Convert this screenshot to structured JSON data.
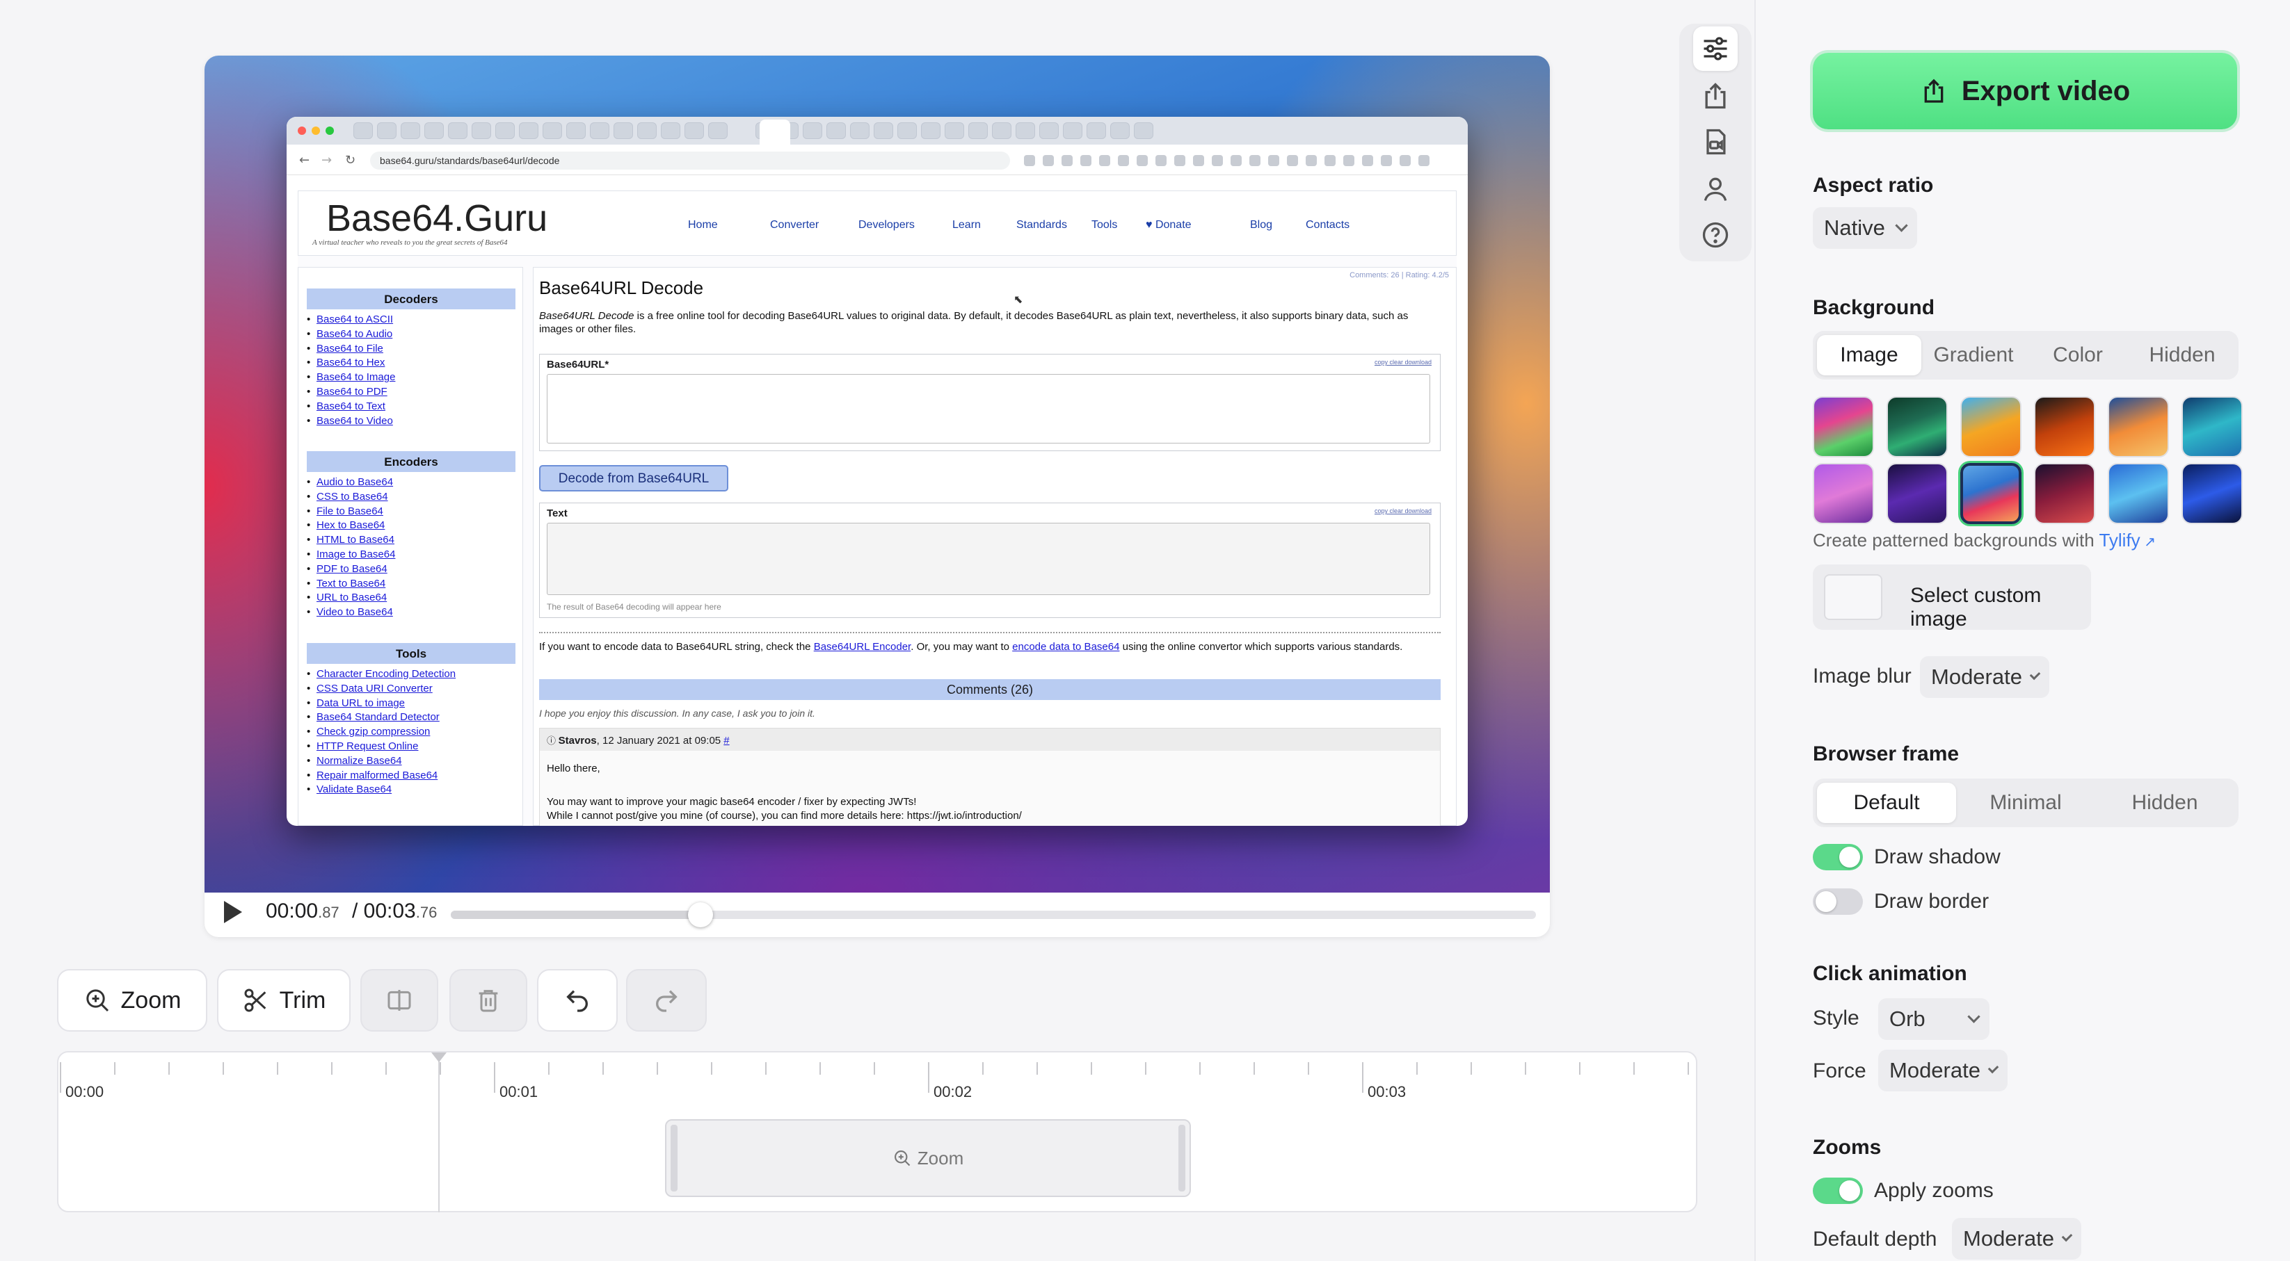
{
  "colors": {
    "accent": "#5bd98a",
    "export_bg": "#5fe88e",
    "link": "#3d7bf0"
  },
  "browser": {
    "url": "base64.guru/standards/base64url/decode",
    "site": {
      "logo": "Base64.Guru",
      "tagline": "A virtual teacher who reveals to you the great secrets of Base64",
      "nav": [
        "Home",
        "Converter",
        "Developers",
        "Learn",
        "Standards",
        "Tools",
        "♥ Donate",
        "Blog",
        "Contacts"
      ],
      "sidebar": {
        "decoders_title": "Decoders",
        "decoders": [
          "Base64 to ASCII",
          "Base64 to Audio",
          "Base64 to File",
          "Base64 to Hex",
          "Base64 to Image",
          "Base64 to PDF",
          "Base64 to Text",
          "Base64 to Video"
        ],
        "encoders_title": "Encoders",
        "encoders": [
          "Audio to Base64",
          "CSS to Base64",
          "File to Base64",
          "Hex to Base64",
          "HTML to Base64",
          "Image to Base64",
          "PDF to Base64",
          "Text to Base64",
          "URL to Base64",
          "Video to Base64"
        ],
        "tools_title": "Tools",
        "tools": [
          "Character Encoding Detection",
          "CSS Data URI Converter",
          "Data URL to image",
          "Base64 Standard Detector",
          "Check gzip compression",
          "HTTP Request Online",
          "Normalize Base64",
          "Repair malformed Base64",
          "Validate Base64"
        ]
      },
      "main": {
        "meta": "Comments: 26 | Rating: 4.2/5",
        "title": "Base64URL Decode",
        "intro_italic": "Base64URL Decode",
        "intro": " is a free online tool for decoding Base64URL values to original data. By default, it decodes Base64URL as plain text, nevertheless, it also supports binary data, such as images or other files.",
        "input_label": "Base64URL*",
        "mini_links": "copy   clear   download",
        "decode_button": "Decode from Base64URL",
        "output_label": "Text",
        "output_placeholder": "The result of Base64 decoding will appear here",
        "encode_text_1": "If you want to encode data to Base64URL string, check the ",
        "encode_link_1": "Base64URL Encoder",
        "encode_text_2": ". Or, you may want to ",
        "encode_link_2": "encode data to Base64",
        "encode_text_3": " using the online convertor which supports various standards.",
        "comments_title": "Comments (26)",
        "comments_intro": "I hope you enjoy this discussion. In any case, I ask you to join it.",
        "comment_author": "Stavros",
        "comment_date": ", 12 January 2021 at 09:05 ",
        "comment_hash": "#",
        "comment_line1": "Hello there,",
        "comment_line2": "You may want to improve your magic base64 encoder / fixer by expecting JWTs!",
        "comment_line3": "While I cannot post/give you mine (of course), you can find more details here: https://jwt.io/introduction/"
      }
    }
  },
  "player": {
    "current_main": "00:00",
    "current_frac": ".87",
    "separator": " / ",
    "total_main": "00:03",
    "total_frac": ".76",
    "progress": 0.23
  },
  "toolbar": {
    "zoom_label": "Zoom",
    "trim_label": "Trim"
  },
  "timeline": {
    "labels": [
      "00:00",
      "00:01",
      "00:02",
      "00:03"
    ],
    "zoom_clip_label": "Zoom"
  },
  "panel": {
    "export_label": "Export video",
    "aspect_ratio_label": "Aspect ratio",
    "aspect_ratio_value": "Native",
    "background_label": "Background",
    "background_tabs": [
      "Image",
      "Gradient",
      "Color",
      "Hidden"
    ],
    "background_active": 0,
    "selected_swatch": 8,
    "patterned_text": "Create patterned backgrounds with ",
    "patterned_link": "Tylify",
    "custom_image_label": "Select custom image",
    "image_blur_label": "Image blur",
    "image_blur_value": "Moderate",
    "browser_frame_label": "Browser frame",
    "frame_tabs": [
      "Default",
      "Minimal",
      "Hidden"
    ],
    "frame_active": 0,
    "draw_shadow_label": "Draw shadow",
    "draw_shadow_on": true,
    "draw_border_label": "Draw border",
    "draw_border_on": false,
    "click_animation_label": "Click animation",
    "style_label": "Style",
    "style_value": "Orb",
    "force_label": "Force",
    "force_value": "Moderate",
    "zooms_label": "Zooms",
    "apply_zooms_label": "Apply zooms",
    "apply_zooms_on": true,
    "default_depth_label": "Default depth",
    "default_depth_value": "Moderate"
  }
}
